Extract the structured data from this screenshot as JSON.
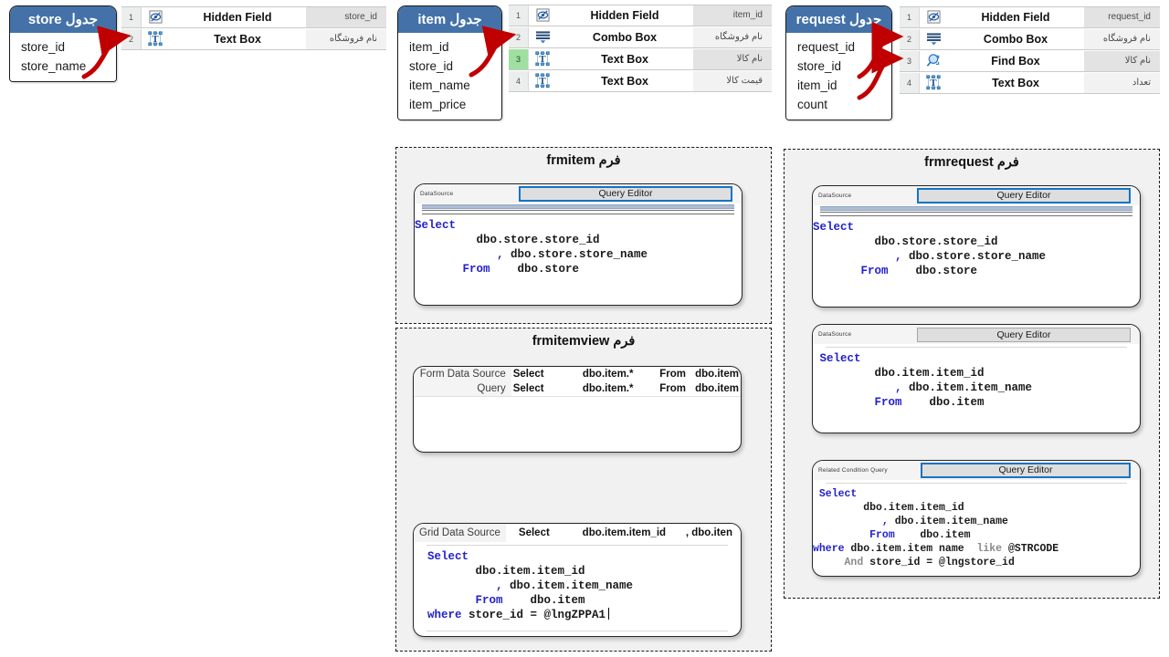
{
  "entities": [
    {
      "id": "store",
      "title": "جدول store",
      "fields": [
        "store_id",
        "store_name"
      ]
    },
    {
      "id": "item",
      "title": "جدول item",
      "fields": [
        "item_id",
        "store_id",
        "item_name",
        "item_price"
      ]
    },
    {
      "id": "request",
      "title": "جدول request",
      "fields": [
        "request_id",
        "store_id",
        "item_id",
        "count"
      ]
    }
  ],
  "control_grids": [
    {
      "id": "store-controls",
      "rows": [
        {
          "num": "1",
          "icon": "hidden-field-icon",
          "label": "Hidden Field",
          "desc": "store_id",
          "selected": false,
          "highlight": false
        },
        {
          "num": "2",
          "icon": "text-box-icon",
          "label": "Text Box",
          "desc": "نام فروشگاه",
          "selected": true,
          "highlight": false
        }
      ]
    },
    {
      "id": "item-controls",
      "rows": [
        {
          "num": "1",
          "icon": "hidden-field-icon",
          "label": "Hidden Field",
          "desc": "item_id",
          "selected": false,
          "highlight": false
        },
        {
          "num": "2",
          "icon": "combo-box-icon",
          "label": "Combo Box",
          "desc": "نام فروشگاه",
          "selected": false,
          "highlight": false
        },
        {
          "num": "3",
          "icon": "text-box-icon",
          "label": "Text Box",
          "desc": "نام کالا",
          "selected": true,
          "highlight": true
        },
        {
          "num": "4",
          "icon": "text-box-icon",
          "label": "Text Box",
          "desc": "قیمت کالا",
          "selected": true,
          "highlight": false
        }
      ]
    },
    {
      "id": "request-controls",
      "rows": [
        {
          "num": "1",
          "icon": "hidden-field-icon",
          "label": "Hidden Field",
          "desc": "request_id",
          "selected": false,
          "highlight": false
        },
        {
          "num": "2",
          "icon": "combo-box-icon",
          "label": "Combo Box",
          "desc": "نام فروشگاه",
          "selected": false,
          "highlight": false
        },
        {
          "num": "3",
          "icon": "find-box-icon",
          "label": "Find Box",
          "desc": "نام کالا",
          "selected": false,
          "highlight": false
        },
        {
          "num": "4",
          "icon": "text-box-icon",
          "label": "Text Box",
          "desc": "تعداد",
          "selected": true,
          "highlight": false
        }
      ]
    }
  ],
  "panels": {
    "frmitem": {
      "title": "فرم frmitem",
      "query_box": {
        "source_label": "DataSource",
        "button_label": "Query Editor",
        "focused": true,
        "sql_lines": [
          {
            "indent": 0,
            "parts": [
              {
                "t": "Select",
                "c": "kw"
              }
            ]
          },
          {
            "indent": 9,
            "parts": [
              {
                "t": "dbo.store.store_id",
                "c": ""
              }
            ]
          },
          {
            "indent": 12,
            "parts": [
              {
                "t": ", ",
                "c": "kw"
              },
              {
                "t": "dbo.store.store_name",
                "c": ""
              }
            ]
          },
          {
            "indent": 7,
            "parts": [
              {
                "t": "From",
                "c": "kw"
              },
              {
                "t": "    dbo.store",
                "c": ""
              }
            ]
          }
        ]
      }
    },
    "frmitemview": {
      "title": "فرم frmitemview",
      "form_source_box": {
        "rows": [
          {
            "label": "Form Data Source",
            "op": "Select",
            "cols": "dbo.item.*",
            "from": "From",
            "table": "dbo.item"
          },
          {
            "label": "Query",
            "op": "Select",
            "cols": "dbo.item.*",
            "from": "From",
            "table": "dbo.item"
          }
        ]
      },
      "grid_source_box": {
        "header": {
          "label": "Grid Data Source",
          "op": "Select",
          "col1": "dbo.item.item_id",
          "col2": ", dbo.iten"
        },
        "sql_lines": [
          {
            "indent": 2,
            "parts": [
              {
                "t": "Select",
                "c": "kw"
              }
            ]
          },
          {
            "indent": 9,
            "parts": [
              {
                "t": "dbo.item.item_id",
                "c": ""
              }
            ]
          },
          {
            "indent": 12,
            "parts": [
              {
                "t": ", ",
                "c": "kw"
              },
              {
                "t": "dbo.item.item_name",
                "c": ""
              }
            ]
          },
          {
            "indent": 9,
            "parts": [
              {
                "t": "From",
                "c": "kw"
              },
              {
                "t": "    dbo.item",
                "c": ""
              }
            ]
          },
          {
            "indent": 2,
            "parts": [
              {
                "t": "where",
                "c": "kw"
              },
              {
                "t": " store_id = @lngZPPA1",
                "c": ""
              }
            ],
            "caret": true
          }
        ]
      }
    },
    "frmrequest": {
      "title": "فرم frmrequest",
      "query_box_store": {
        "source_label": "DataSource",
        "button_label": "Query Editor",
        "focused": true,
        "sql_lines": [
          {
            "indent": 0,
            "parts": [
              {
                "t": "Select",
                "c": "kw"
              }
            ]
          },
          {
            "indent": 9,
            "parts": [
              {
                "t": "dbo.store.store_id",
                "c": ""
              }
            ]
          },
          {
            "indent": 12,
            "parts": [
              {
                "t": ", ",
                "c": "kw"
              },
              {
                "t": "dbo.store.store_name",
                "c": ""
              }
            ]
          },
          {
            "indent": 7,
            "parts": [
              {
                "t": "From",
                "c": "kw"
              },
              {
                "t": "    dbo.store",
                "c": ""
              }
            ]
          }
        ]
      },
      "query_box_item": {
        "source_label": "DataSource",
        "button_label": "Query Editor",
        "focused": false,
        "sql_lines": [
          {
            "indent": 1,
            "parts": [
              {
                "t": "Select",
                "c": "kw"
              }
            ]
          },
          {
            "indent": 9,
            "parts": [
              {
                "t": "dbo.item.item_id",
                "c": ""
              }
            ]
          },
          {
            "indent": 12,
            "parts": [
              {
                "t": ", ",
                "c": "kw"
              },
              {
                "t": "dbo.item.item_name",
                "c": ""
              }
            ]
          },
          {
            "indent": 9,
            "parts": [
              {
                "t": "From",
                "c": "kw"
              },
              {
                "t": "    dbo.item",
                "c": ""
              }
            ]
          }
        ]
      },
      "query_box_condition": {
        "source_label": "Related Condition Query",
        "button_label": "Query Editor",
        "focused": true,
        "sql_lines": [
          {
            "indent": 1,
            "parts": [
              {
                "t": "Select",
                "c": "kw"
              }
            ]
          },
          {
            "indent": 8,
            "parts": [
              {
                "t": "dbo.item.item_id",
                "c": ""
              }
            ]
          },
          {
            "indent": 11,
            "parts": [
              {
                "t": ", ",
                "c": "kw"
              },
              {
                "t": "dbo.item.item_name",
                "c": ""
              }
            ]
          },
          {
            "indent": 9,
            "parts": [
              {
                "t": "From",
                "c": "kw"
              },
              {
                "t": "    dbo.item",
                "c": ""
              }
            ]
          },
          {
            "indent": 0,
            "parts": [
              {
                "t": "where",
                "c": "kw"
              },
              {
                "t": " dbo.item.item name  ",
                "c": ""
              },
              {
                "t": "like",
                "c": "dim"
              },
              {
                "t": " @STRCODE",
                "c": ""
              }
            ]
          },
          {
            "indent": 5,
            "parts": [
              {
                "t": "And",
                "c": "dim"
              },
              {
                "t": " store_id = @lngstore_id",
                "c": ""
              }
            ]
          }
        ]
      }
    }
  },
  "colors": {
    "entity_header": "#4472a8",
    "accent_blue": "#1673c4",
    "sql_keyword": "#2222cc",
    "arrow_red": "#c00000",
    "highlight_green": "#9fe0a0"
  }
}
